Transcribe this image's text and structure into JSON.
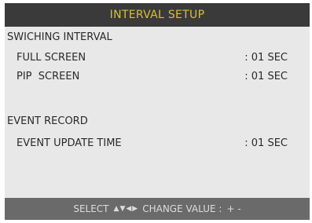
{
  "header": {
    "title": "INTERVAL SETUP"
  },
  "sections": {
    "switching": {
      "label": "SWICHING INTERVAL",
      "rows": [
        {
          "label": "FULL SCREEN",
          "value": ": 01 SEC"
        },
        {
          "label": "PIP  SCREEN",
          "value": ": 01 SEC"
        }
      ]
    },
    "event": {
      "label": "EVENT RECORD",
      "rows": [
        {
          "label": "EVENT UPDATE TIME",
          "value": ": 01 SEC"
        }
      ]
    }
  },
  "footer": {
    "select_label": "SELECT",
    "change_label": "CHANGE VALUE :",
    "change_keys": "+ -"
  },
  "icons": {
    "up": "triangle-up-icon",
    "down": "triangle-down-icon",
    "left": "triangle-left-icon",
    "right": "triangle-right-icon"
  },
  "colors": {
    "title_bg": "#3a3a3a",
    "title_text": "#d8c030",
    "panel_bg": "#e8e8e8",
    "footer_bg": "#6a6a6a",
    "footer_text": "#dcdcdc"
  }
}
